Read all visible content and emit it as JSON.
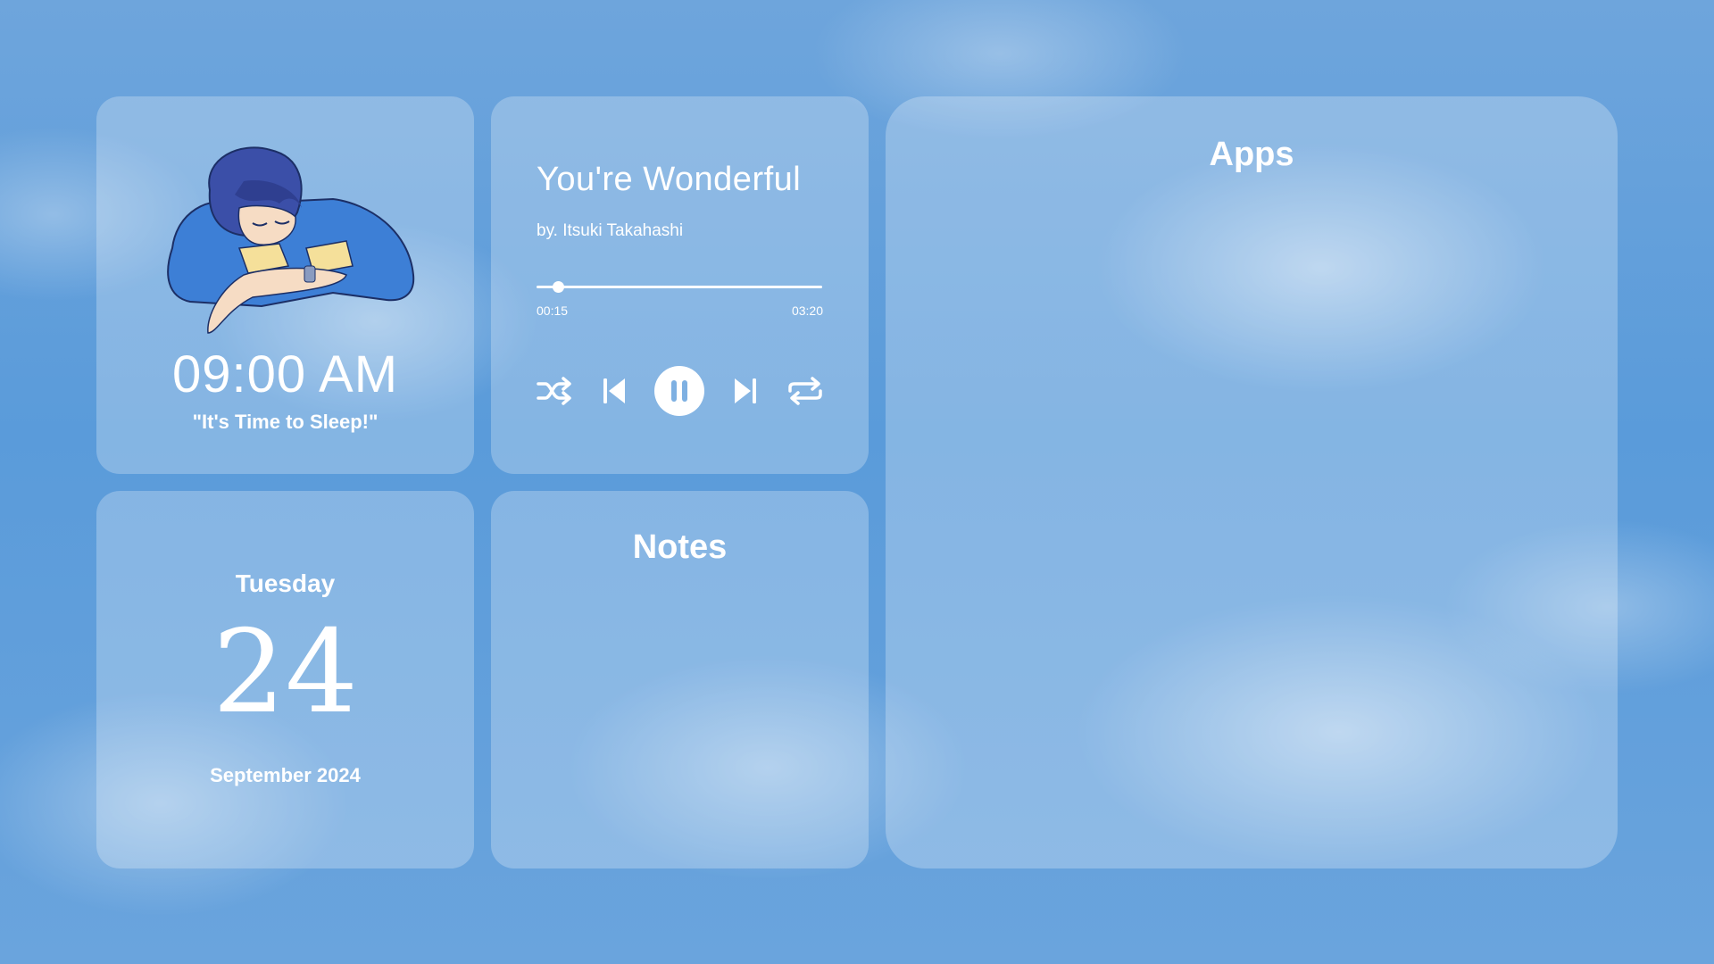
{
  "clock": {
    "time": "09:00 AM",
    "message": "\"It's Time to Sleep!\"",
    "illustration": "sleeping-boy-illustration"
  },
  "music": {
    "title": "You're Wonderful",
    "artist": "by. Itsuki Takahashi",
    "elapsed": "00:15",
    "total": "03:20",
    "progress": 0.075,
    "controls": [
      "shuffle-icon",
      "skip-previous-icon",
      "pause-icon",
      "skip-next-icon",
      "repeat-icon"
    ]
  },
  "date": {
    "weekday": "Tuesday",
    "day": "24",
    "month_year": "September 2024"
  },
  "notes": {
    "title": "Notes"
  },
  "apps": {
    "title": "Apps"
  },
  "colors": {
    "sky": "#5a9bda",
    "card": "rgba(255,255,255,0.26)",
    "text": "#ffffff",
    "hair": "#3b4fa8",
    "sweater": "#3d7fd6"
  }
}
